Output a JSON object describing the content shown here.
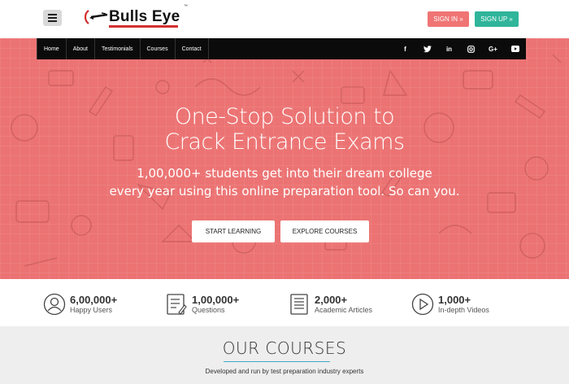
{
  "header": {
    "logo_text": "Bulls Eye",
    "logo_tm": "™",
    "signin_label": "SIGN IN »",
    "signup_label": "SIGN UP »"
  },
  "nav": {
    "items": [
      {
        "label": "Home"
      },
      {
        "label": "About"
      },
      {
        "label": "Testimonials"
      },
      {
        "label": "Courses"
      },
      {
        "label": "Contact"
      }
    ],
    "social": [
      {
        "icon": "facebook-icon",
        "glyph": "f"
      },
      {
        "icon": "twitter-icon",
        "glyph": "t"
      },
      {
        "icon": "linkedin-icon",
        "glyph": "in"
      },
      {
        "icon": "instagram-icon",
        "glyph": "◎"
      },
      {
        "icon": "google-plus-icon",
        "glyph": "G+"
      },
      {
        "icon": "youtube-icon",
        "glyph": "▶"
      }
    ]
  },
  "hero": {
    "title_line1": "One-Stop Solution to",
    "title_line2": "Crack Entrance Exams",
    "subtitle_line1": "1,00,000+ students get into their dream college",
    "subtitle_line2": "every year using this online preparation tool. So can you.",
    "start_label": "START LEARNING",
    "explore_label": "EXPLORE COURSES",
    "bg_color": "#ec7373"
  },
  "stats": [
    {
      "number": "6,00,000+",
      "label": "Happy Users",
      "icon": "users-icon"
    },
    {
      "number": "1,00,000+",
      "label": "Questions",
      "icon": "questions-icon"
    },
    {
      "number": "2,000+",
      "label": "Academic Articles",
      "icon": "articles-icon"
    },
    {
      "number": "1,000+",
      "label": "In-depth Videos",
      "icon": "video-play-icon"
    }
  ],
  "courses": {
    "title": "OUR COURSES",
    "subtitle": "Developed and run by test preparation industry experts"
  },
  "colors": {
    "signin": "#f07474",
    "signup": "#2fb59a",
    "accent_rule": "#3fa9c9"
  }
}
